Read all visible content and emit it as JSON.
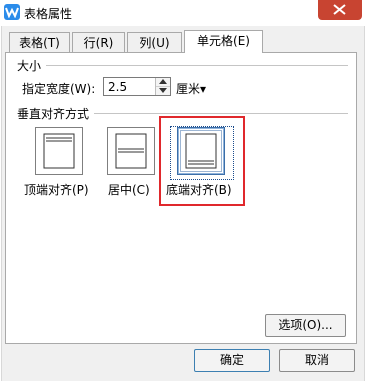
{
  "window": {
    "title": "表格属性",
    "icon": "wps-logo-icon",
    "close_icon": "close-icon"
  },
  "tabs": [
    {
      "label": "表格(T)",
      "active": false
    },
    {
      "label": "行(R)",
      "active": false
    },
    {
      "label": "列(U)",
      "active": false
    },
    {
      "label": "单元格(E)",
      "active": true
    }
  ],
  "size_group": {
    "title": "大小",
    "width_label": "指定宽度(W):",
    "width_value": "2.5",
    "unit": "厘米▾"
  },
  "valign_group": {
    "title": "垂直对齐方式",
    "options": [
      {
        "label": "顶端对齐(P)",
        "icon": "align-top-icon",
        "selected": false
      },
      {
        "label": "居中(C)",
        "icon": "align-center-icon",
        "selected": false
      },
      {
        "label": "底端对齐(B)",
        "icon": "align-bottom-icon",
        "selected": true
      }
    ]
  },
  "buttons": {
    "options": "选项(O)...",
    "ok": "确定",
    "cancel": "取消"
  },
  "colors": {
    "highlight": "#e0282c",
    "title_bar": "#ffffff",
    "close": "#c84431"
  }
}
